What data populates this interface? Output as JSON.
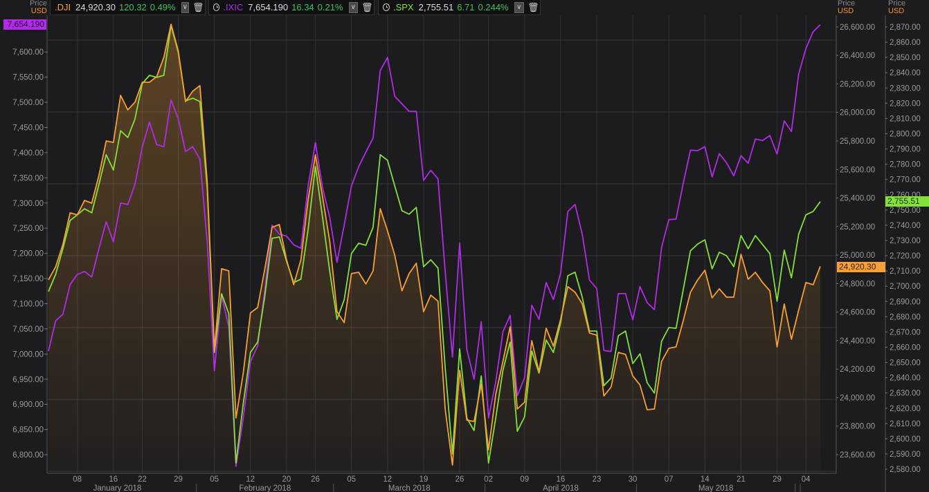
{
  "axis_headers": {
    "left": {
      "price": "Price",
      "currency": "USD"
    },
    "middle": {
      "price": "Price",
      "currency": "USD"
    },
    "right": {
      "price": "Price",
      "currency": "USD"
    }
  },
  "instruments": [
    {
      "ticker": ".DJI",
      "price": "24,920.30",
      "change": "120.32",
      "pct": "0.49%",
      "color": "#f7a035",
      "clock": false
    },
    {
      "ticker": ".IXIC",
      "price": "7,654.190",
      "change": "16.34",
      "pct": "0.21%",
      "color": "#b22be8",
      "clock": true
    },
    {
      "ticker": ".SPX",
      "price": "2,755.51",
      "change": "6.71",
      "pct": "0.244%",
      "color": "#86e03a",
      "clock": true
    }
  ],
  "badges": {
    "ixic": "7,654.190",
    "dji": "24,920.30",
    "spx": "2,755.51"
  },
  "chart_data": {
    "type": "line",
    "title": "",
    "xlabel": "",
    "grid": true,
    "dates": [
      "2018-01-02",
      "2018-01-03",
      "2018-01-04",
      "2018-01-05",
      "2018-01-08",
      "2018-01-09",
      "2018-01-10",
      "2018-01-11",
      "2018-01-12",
      "2018-01-16",
      "2018-01-17",
      "2018-01-18",
      "2018-01-19",
      "2018-01-22",
      "2018-01-23",
      "2018-01-24",
      "2018-01-25",
      "2018-01-26",
      "2018-01-29",
      "2018-01-30",
      "2018-01-31",
      "2018-02-01",
      "2018-02-02",
      "2018-02-05",
      "2018-02-06",
      "2018-02-07",
      "2018-02-08",
      "2018-02-09",
      "2018-02-12",
      "2018-02-13",
      "2018-02-14",
      "2018-02-15",
      "2018-02-16",
      "2018-02-20",
      "2018-02-21",
      "2018-02-22",
      "2018-02-23",
      "2018-02-26",
      "2018-02-27",
      "2018-02-28",
      "2018-03-01",
      "2018-03-02",
      "2018-03-05",
      "2018-03-06",
      "2018-03-07",
      "2018-03-08",
      "2018-03-09",
      "2018-03-12",
      "2018-03-13",
      "2018-03-14",
      "2018-03-15",
      "2018-03-16",
      "2018-03-19",
      "2018-03-20",
      "2018-03-21",
      "2018-03-22",
      "2018-03-23",
      "2018-03-26",
      "2018-03-27",
      "2018-03-28",
      "2018-03-29",
      "2018-04-02",
      "2018-04-03",
      "2018-04-04",
      "2018-04-05",
      "2018-04-06",
      "2018-04-09",
      "2018-04-10",
      "2018-04-11",
      "2018-04-12",
      "2018-04-13",
      "2018-04-16",
      "2018-04-17",
      "2018-04-18",
      "2018-04-19",
      "2018-04-20",
      "2018-04-23",
      "2018-04-24",
      "2018-04-25",
      "2018-04-26",
      "2018-04-27",
      "2018-04-30",
      "2018-05-01",
      "2018-05-02",
      "2018-05-03",
      "2018-05-04",
      "2018-05-07",
      "2018-05-08",
      "2018-05-09",
      "2018-05-10",
      "2018-05-11",
      "2018-05-14",
      "2018-05-15",
      "2018-05-16",
      "2018-05-17",
      "2018-05-18",
      "2018-05-21",
      "2018-05-22",
      "2018-05-23",
      "2018-05-24",
      "2018-05-25",
      "2018-05-29",
      "2018-05-30",
      "2018-05-31",
      "2018-06-01",
      "2018-06-04",
      "2018-06-05",
      "2018-06-06"
    ],
    "x_ticks": [
      {
        "label": "08",
        "date": "2018-01-08"
      },
      {
        "label": "16",
        "date": "2018-01-16"
      },
      {
        "label": "22",
        "date": "2018-01-22"
      },
      {
        "label": "29",
        "date": "2018-01-29"
      },
      {
        "label": "05",
        "date": "2018-02-05"
      },
      {
        "label": "12",
        "date": "2018-02-12"
      },
      {
        "label": "20",
        "date": "2018-02-20"
      },
      {
        "label": "26",
        "date": "2018-02-26"
      },
      {
        "label": "05",
        "date": "2018-03-05"
      },
      {
        "label": "12",
        "date": "2018-03-12"
      },
      {
        "label": "19",
        "date": "2018-03-19"
      },
      {
        "label": "26",
        "date": "2018-03-26"
      },
      {
        "label": "02",
        "date": "2018-04-02"
      },
      {
        "label": "09",
        "date": "2018-04-09"
      },
      {
        "label": "16",
        "date": "2018-04-16"
      },
      {
        "label": "23",
        "date": "2018-04-23"
      },
      {
        "label": "30",
        "date": "2018-04-30"
      },
      {
        "label": "07",
        "date": "2018-05-07"
      },
      {
        "label": "14",
        "date": "2018-05-14"
      },
      {
        "label": "21",
        "date": "2018-05-21"
      },
      {
        "label": "29",
        "date": "2018-05-29"
      },
      {
        "label": "04",
        "date": "2018-06-04"
      }
    ],
    "months": [
      "January 2018",
      "February 2018",
      "March 2018",
      "April 2018",
      "May 2018"
    ],
    "axes": {
      "ixic": {
        "position": "left",
        "ylim": [
          6763,
          7673
        ],
        "tick_start": 6800,
        "tick_end": 7600,
        "tick_step": 50
      },
      "dji": {
        "position": "middle",
        "ylim": [
          23469,
          26682
        ],
        "tick_start": 23600,
        "tick_end": 26600,
        "tick_step": 200
      },
      "spx": {
        "position": "right",
        "ylim": [
          2577.3,
          2877.7
        ],
        "tick_start": 2580,
        "tick_end": 2870,
        "tick_step": 10
      }
    },
    "series": [
      {
        "name": ".IXIC",
        "axis": "ixic",
        "color": "#b22be8",
        "fill": false,
        "values": [
          7006,
          7066,
          7079,
          7138,
          7158,
          7164,
          7153,
          7209,
          7263,
          7223,
          7300,
          7297,
          7337,
          7411,
          7461,
          7416,
          7412,
          7505,
          7467,
          7402,
          7412,
          7387,
          7223,
          6967,
          7116,
          7054,
          6777,
          6873,
          6985,
          7016,
          7128,
          7256,
          7238,
          7234,
          7217,
          7210,
          7334,
          7420,
          7330,
          7271,
          7182,
          7256,
          7334,
          7372,
          7401,
          7429,
          7563,
          7589,
          7512,
          7497,
          7482,
          7482,
          7345,
          7365,
          7348,
          7164,
          6994,
          7220,
          7009,
          6950,
          7064,
          6873,
          6944,
          7044,
          7077,
          6917,
          6953,
          7097,
          7069,
          7142,
          7108,
          7161,
          7283,
          7297,
          7238,
          7147,
          7130,
          7007,
          7005,
          7120,
          7120,
          7068,
          7134,
          7102,
          7088,
          7212,
          7267,
          7268,
          7339,
          7405,
          7404,
          7412,
          7352,
          7398,
          7380,
          7354,
          7394,
          7379,
          7427,
          7424,
          7434,
          7397,
          7463,
          7442,
          7556,
          7607,
          7640,
          7654.19
        ]
      },
      {
        "name": ".SPX",
        "axis": "spx",
        "color": "#86e03a",
        "fill": false,
        "values": [
          2696.5,
          2707.8,
          2724.6,
          2743.1,
          2746.8,
          2750.8,
          2748.1,
          2766.7,
          2786.2,
          2776.2,
          2802.0,
          2797.5,
          2809.7,
          2832.8,
          2838.3,
          2836.9,
          2838.3,
          2870.9,
          2853.2,
          2821.5,
          2823.3,
          2821.1,
          2764.4,
          2656.6,
          2695.1,
          2682.0,
          2584.1,
          2623.1,
          2656.6,
          2663.4,
          2693.7,
          2731.4,
          2732.3,
          2716.4,
          2702.4,
          2704.6,
          2737.2,
          2778.5,
          2744.9,
          2709.6,
          2678.3,
          2691.0,
          2721.4,
          2728.2,
          2726.8,
          2738.6,
          2786.2,
          2782.5,
          2765.8,
          2749.5,
          2747.2,
          2751.7,
          2712.8,
          2717.3,
          2711.9,
          2646.6,
          2590.0,
          2658.9,
          2613.5,
          2605.4,
          2641.2,
          2584.1,
          2613.5,
          2644.8,
          2663.4,
          2604.9,
          2614.4,
          2657.5,
          2643.0,
          2664.7,
          2656.6,
          2676.1,
          2706.9,
          2709.2,
          2692.8,
          2670.6,
          2670.6,
          2634.8,
          2639.8,
          2667.5,
          2670.6,
          2649.3,
          2655.7,
          2636.7,
          2629.9,
          2663.8,
          2672.9,
          2672.4,
          2697.8,
          2723.2,
          2727.7,
          2730.4,
          2711.4,
          2722.3,
          2720.0,
          2712.8,
          2733.2,
          2724.6,
          2733.2,
          2727.3,
          2721.4,
          2690.1,
          2723.7,
          2705.5,
          2734.1,
          2746.8,
          2749.0,
          2755.51
        ]
      },
      {
        "name": ".DJI",
        "axis": "dji",
        "color": "#f7a035",
        "fill": true,
        "values": [
          24826,
          24918,
          25073,
          25296,
          25282,
          25383,
          25364,
          25558,
          25800,
          25790,
          26120,
          26018,
          26072,
          26212,
          26212,
          26251,
          26387,
          26619,
          26430,
          26076,
          26149,
          26188,
          25514,
          24337,
          24904,
          24889,
          23857,
          24172,
          24594,
          24632,
          24904,
          25194,
          25214,
          24967,
          24792,
          24967,
          25388,
          25703,
          25408,
          25093,
          24603,
          24526,
          24870,
          24879,
          24797,
          24889,
          25325,
          25170,
          25000,
          24749,
          24870,
          24942,
          24603,
          24719,
          24676,
          23920,
          23527,
          24191,
          23842,
          23833,
          24094,
          23634,
          24022,
          24254,
          24497,
          23920,
          23968,
          24400,
          24182,
          24487,
          24361,
          24550,
          24778,
          24739,
          24657,
          24453,
          24438,
          24012,
          24075,
          24317,
          24303,
          24152,
          24089,
          23915,
          23920,
          24254,
          24346,
          24356,
          24540,
          24739,
          24826,
          24894,
          24700,
          24763,
          24705,
          24705,
          25005,
          24831,
          24879,
          24807,
          24749,
          24356,
          24657,
          24409,
          24613,
          24807,
          24792,
          24920.3
        ]
      }
    ]
  }
}
